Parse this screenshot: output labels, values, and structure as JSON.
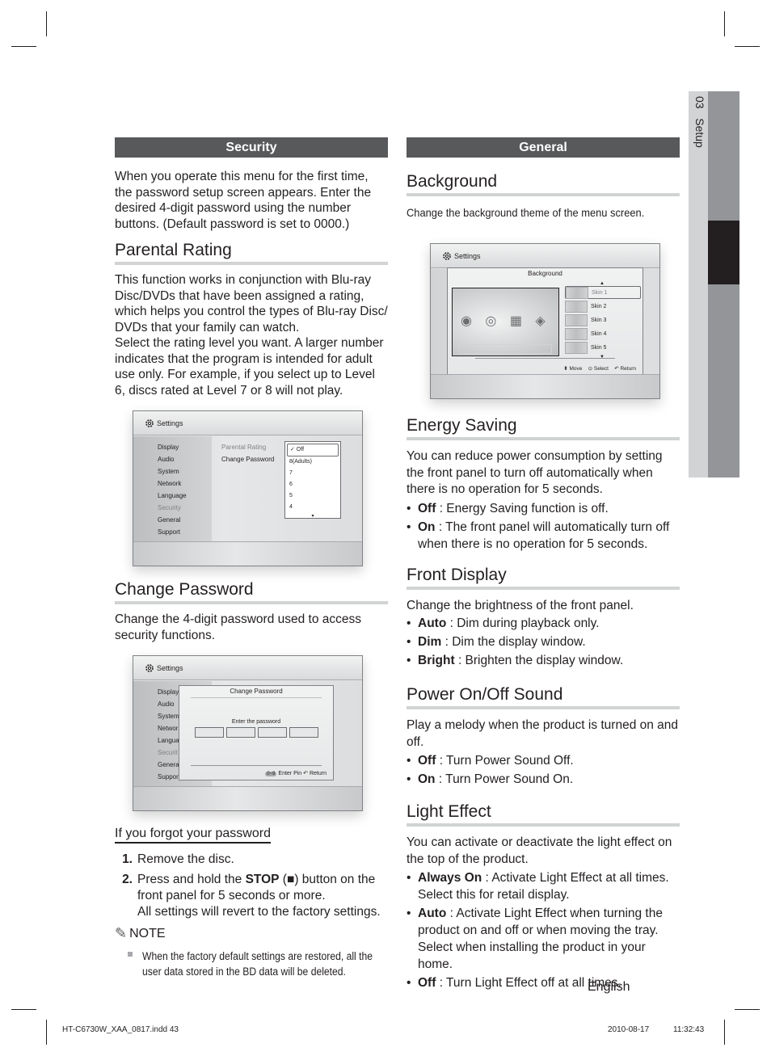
{
  "side_tab": {
    "chapter_number": "03",
    "chapter_title": "Setup"
  },
  "left": {
    "section_bar": "Security",
    "intro": "When you operate this menu for the first time, the password setup screen appears. Enter the desired 4-digit password using the number buttons. (Default password is set to 0000.)",
    "parental_rating": {
      "heading": "Parental Rating",
      "p1": "This function works in conjunction with Blu-ray Disc/DVDs that have been assigned a rating, which helps you control the types of Blu-ray Disc/ DVDs that your family can watch.",
      "p2": "Select the rating level you want. A larger number indicates that the program is intended for adult use only. For example, if you select up to Level 6, discs rated at Level 7 or 8 will not play.",
      "screen": {
        "title": "Settings",
        "menu": [
          "Display",
          "Audio",
          "System",
          "Network",
          "Language",
          "Security",
          "General",
          "Support"
        ],
        "active_menu": "Security",
        "submenu": [
          "Parental Rating",
          "Change Password"
        ],
        "dropdown": {
          "selected": "✓ Off",
          "options": [
            "8(Adults)",
            "7",
            "6",
            "5",
            "4"
          ],
          "more_arrow": "▾"
        }
      }
    },
    "change_password": {
      "heading": "Change Password",
      "text": "Change the 4-digit password used to access security functions.",
      "screen": {
        "title": "Settings",
        "menu_truncated": [
          "Display",
          "Audio",
          "System",
          "Networ",
          "Langua",
          "Securit",
          "Genera",
          "Suppor"
        ],
        "popup_title": "Change Password",
        "prompt": "Enter the password",
        "pin_boxes": 4,
        "footer_enter": "Enter Pin",
        "footer_return": "Return",
        "keypad_icon_label": "0~9"
      }
    },
    "forgot": {
      "heading": "If you forgot your password",
      "steps": [
        {
          "num": "1.",
          "text": "Remove the disc."
        },
        {
          "num": "2.",
          "pre": "Press and hold the ",
          "bold": "STOP",
          "post": " (■) button on the front panel for 5 seconds or more.",
          "extra": "All settings will revert to the factory settings."
        }
      ],
      "note_label": "NOTE",
      "note_text": "When the factory default settings are restored, all the user data stored in the BD data will be deleted."
    }
  },
  "right": {
    "section_bar": "General",
    "background": {
      "heading": "Background",
      "text": "Change the background theme of the menu screen.",
      "screen": {
        "title": "Settings",
        "popup_title": "Background",
        "skins": [
          "Skin 1",
          "Skin 2",
          "Skin 3",
          "Skin 4",
          "Skin 5"
        ],
        "selected_skin": "Skin 1",
        "footer_move": "Move",
        "footer_select": "Select",
        "footer_return": "Return"
      }
    },
    "energy_saving": {
      "heading": "Energy Saving",
      "text": "You can reduce power consumption by setting the front panel to turn off automatically when there is no operation for 5 seconds.",
      "bullets": [
        {
          "term": "Off",
          "desc": " : Energy Saving function is off."
        },
        {
          "term": "On",
          "desc": " : The front panel will automatically turn off when there is no operation for 5 seconds."
        }
      ]
    },
    "front_display": {
      "heading": "Front Display",
      "text": "Change the brightness of the front panel.",
      "bullets": [
        {
          "term": "Auto",
          "desc": " : Dim during playback only."
        },
        {
          "term": "Dim",
          "desc": " : Dim the display window."
        },
        {
          "term": "Bright",
          "desc": " : Brighten the display window."
        }
      ]
    },
    "power_sound": {
      "heading": "Power On/Off Sound",
      "text": "Play a melody when the product is turned on and off.",
      "bullets": [
        {
          "term": "Off",
          "desc": " : Turn Power Sound Off."
        },
        {
          "term": "On",
          "desc": " : Turn Power Sound On."
        }
      ]
    },
    "light_effect": {
      "heading": "Light Effect",
      "text": "You can activate or deactivate the light effect on the top of the product.",
      "bullets": [
        {
          "term": "Always On",
          "desc": " : Activate Light Effect at all times. Select this for retail display."
        },
        {
          "term": "Auto",
          "desc": " : Activate Light Effect when turning the product on and off or when moving the tray. Select when installing the product in your home."
        },
        {
          "term": "Off",
          "desc": " : Turn Light Effect off at all times."
        }
      ]
    }
  },
  "page_footer": {
    "language": "English",
    "file_name": "HT-C6730W_XAA_0817.indd   43",
    "date": "2010-08-17",
    "time": "11:32:43"
  }
}
